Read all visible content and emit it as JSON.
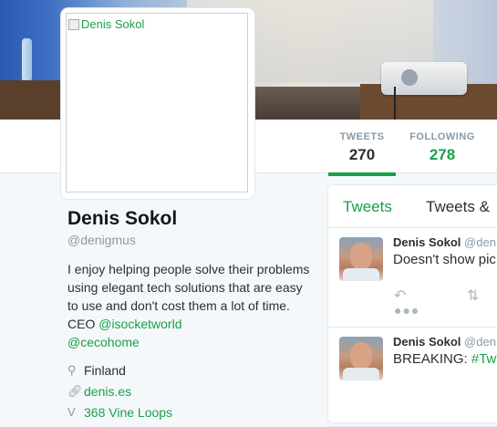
{
  "avatar": {
    "alt_text": "Denis Sokol"
  },
  "stats": [
    {
      "label": "TWEETS",
      "value": "270"
    },
    {
      "label": "FOLLOWING",
      "value": "278"
    }
  ],
  "profile": {
    "name": "Denis Sokol",
    "handle": "@denigmus",
    "bio_text": "I enjoy helping people solve their problems using elegant tech solutions that are easy to use and don't cost them a lot of time. CEO ",
    "bio_link1": "@isocketworld",
    "bio_link2": "@cecohome",
    "location": "Finland",
    "website": "denis.es",
    "vine": "368 Vine Loops"
  },
  "timeline": {
    "tabs": [
      "Tweets",
      "Tweets &"
    ],
    "tweets": [
      {
        "author": "Denis Sokol",
        "handle": "@den",
        "text": "Doesn't show pic",
        "link": ""
      },
      {
        "author": "Denis Sokol",
        "handle": "@den",
        "text": "BREAKING: ",
        "link": "#Tw"
      }
    ]
  },
  "colors": {
    "accent": "#19a04a",
    "muted": "#8899a6"
  }
}
